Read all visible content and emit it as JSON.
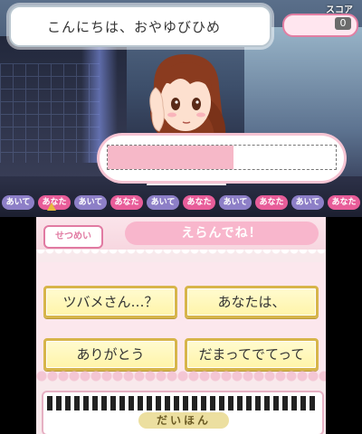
{
  "top": {
    "speech": "こんにちは、おやゆびひめ",
    "score_label": "スコア",
    "score_value": "0",
    "gauge_level_percent": 55,
    "turns": [
      {
        "label": "あいて",
        "kind": "b"
      },
      {
        "label": "あなた",
        "kind": "p"
      },
      {
        "label": "あいて",
        "kind": "b"
      },
      {
        "label": "あなた",
        "kind": "p"
      },
      {
        "label": "あいて",
        "kind": "b"
      },
      {
        "label": "あなた",
        "kind": "p"
      },
      {
        "label": "あいて",
        "kind": "b"
      },
      {
        "label": "あなた",
        "kind": "p"
      },
      {
        "label": "あいて",
        "kind": "b"
      },
      {
        "label": "あなた",
        "kind": "p"
      }
    ]
  },
  "bottom": {
    "manual_button": "せつめい",
    "prompt": "えらんでね！",
    "choices": [
      "ツバメさん…？",
      "あなたは、",
      "ありがとう",
      "だまってでてって"
    ],
    "piano_label": "だいほん"
  },
  "colors": {
    "pink_accent": "#e85d99",
    "gold_border": "#d7b54a"
  }
}
